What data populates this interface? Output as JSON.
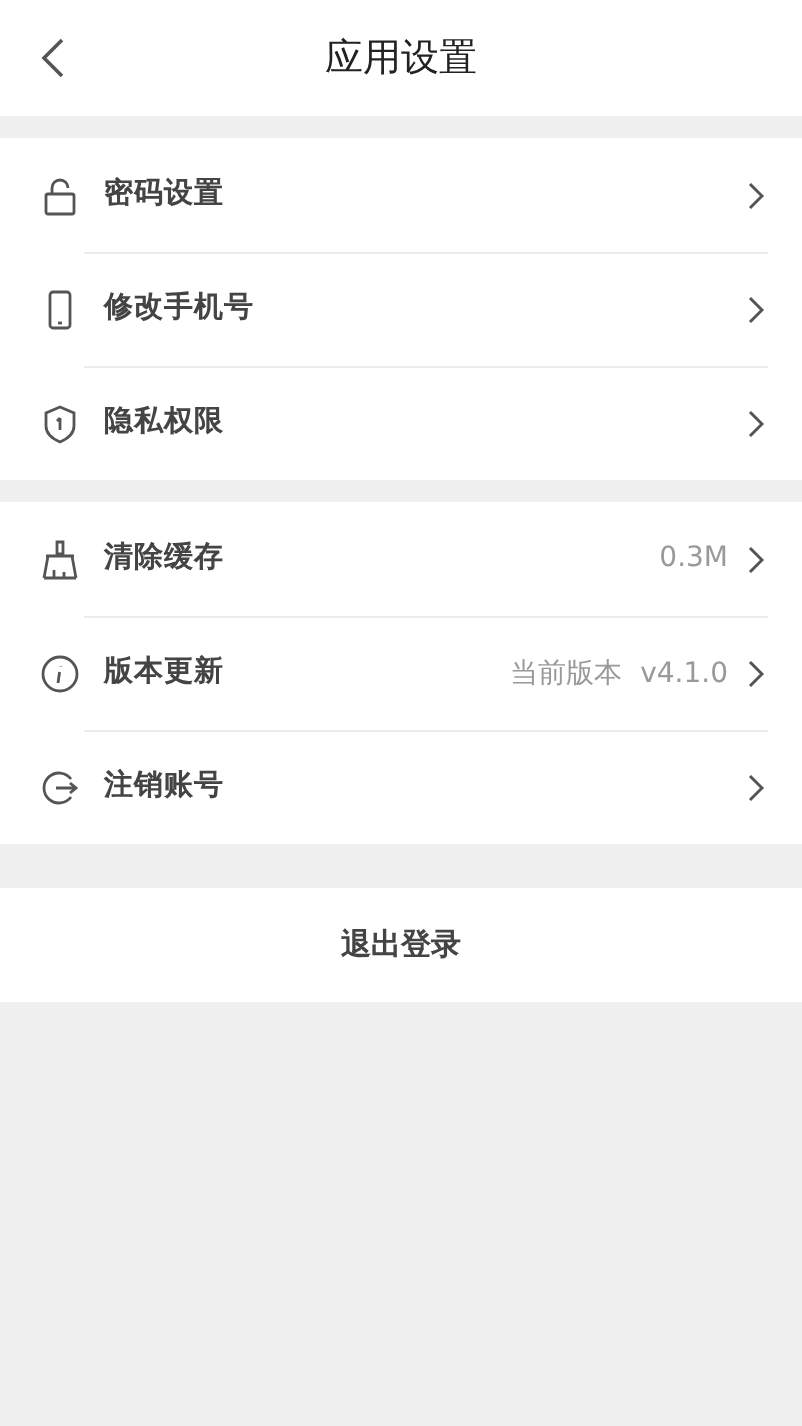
{
  "header": {
    "title": "应用设置"
  },
  "groups": [
    {
      "items": [
        {
          "label": "密码设置"
        },
        {
          "label": "修改手机号"
        },
        {
          "label": "隐私权限"
        }
      ]
    },
    {
      "items": [
        {
          "label": "清除缓存",
          "value": "0.3M"
        },
        {
          "label": "版本更新",
          "value": "当前版本  v4.1.0"
        },
        {
          "label": "注销账号"
        }
      ]
    }
  ],
  "logout_button": "退出登录"
}
